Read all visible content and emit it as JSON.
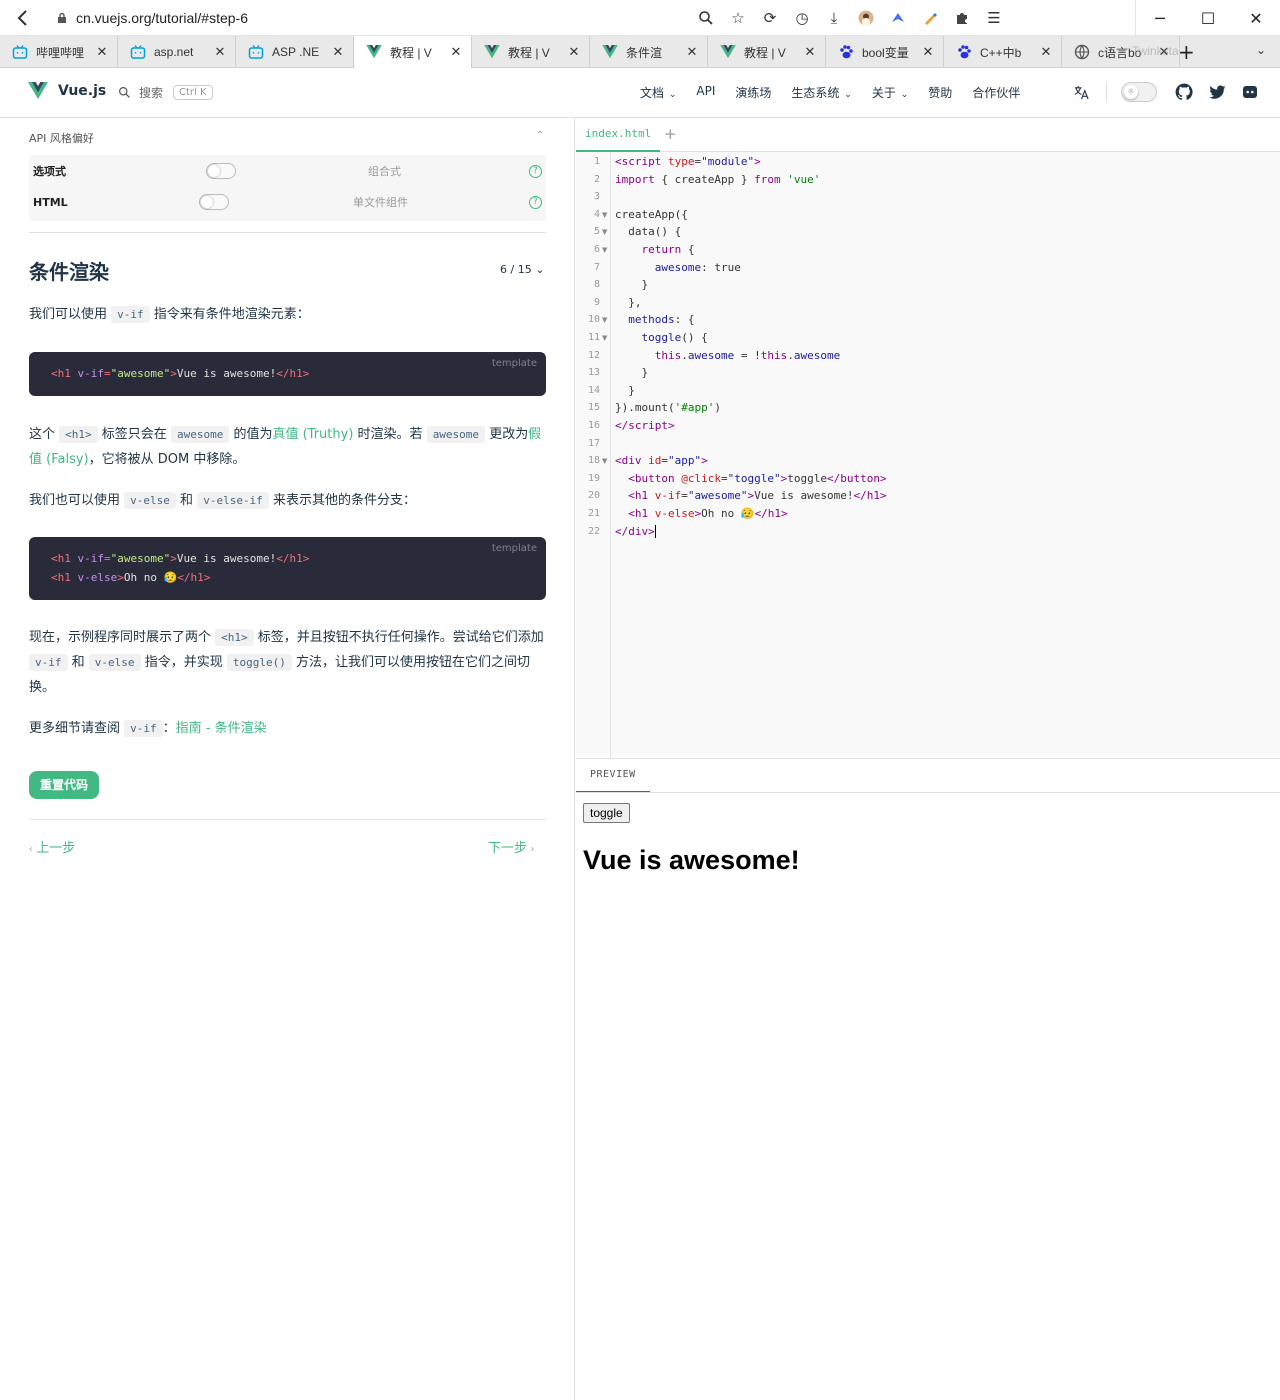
{
  "browser": {
    "url": "cn.vuejs.org/tutorial/#step-6",
    "tabs": [
      {
        "label": "哔哩哔哩",
        "icon": "bilibili-icon",
        "active": false
      },
      {
        "label": "asp.net",
        "icon": "bilibili-icon",
        "active": false
      },
      {
        "label": "ASP .NE",
        "icon": "bilibili-icon",
        "active": false
      },
      {
        "label": "教程 | V",
        "icon": "vue-icon",
        "active": true
      },
      {
        "label": "教程 | V",
        "icon": "vue-icon",
        "active": false
      },
      {
        "label": "条件渲",
        "icon": "vue-icon",
        "active": false
      },
      {
        "label": "教程 | V",
        "icon": "vue-icon",
        "active": false
      },
      {
        "label": "bool变量",
        "icon": "baidu-icon",
        "active": false
      },
      {
        "label": "C++中b",
        "icon": "baidu-icon",
        "active": false
      },
      {
        "label": "c语言bo",
        "icon": "globe-icon",
        "active": false
      }
    ],
    "tab_overlay": "Twinkstar Browser"
  },
  "nav": {
    "logo": "Vue.js",
    "search": "搜索",
    "search_kbd": "Ctrl K",
    "items": [
      "文档",
      "API",
      "演练场",
      "生态系统",
      "关于",
      "赞助",
      "合作伙伴"
    ]
  },
  "prefs": {
    "heading": "API 风格偏好",
    "row1_left": "选项式",
    "row1_right": "组合式",
    "row2_left": "HTML",
    "row2_right": "单文件组件"
  },
  "lesson": {
    "title": "条件渲染",
    "count": "6 / 15",
    "p1_a": "我们可以使用",
    "p1_code": "v-if",
    "p1_b": "指令来有条件地渲染元素：",
    "code1_lang": "template",
    "p2_a": "这个",
    "p2_code1": "<h1>",
    "p2_b": "标签只会在",
    "p2_code2": "awesome",
    "p2_c": "的值为",
    "p2_link1": "真值 (Truthy)",
    "p2_d": "时渲染。若",
    "p2_code3": "awesome",
    "p2_e": "更改为",
    "p2_link2": "假值 (Falsy)",
    "p2_f": "，它将被从 DOM 中移除。",
    "p3_a": "我们也可以使用",
    "p3_code1": "v-else",
    "p3_b": "和",
    "p3_code2": "v-else-if",
    "p3_c": "来表示其他的条件分支：",
    "code2_lang": "template",
    "p4_a": "现在，示例程序同时展示了两个",
    "p4_code1": "<h1>",
    "p4_b": "标签，并且按钮不执行任何操作。尝试给它们添加",
    "p4_code2": "v-if",
    "p4_c": "和",
    "p4_code3": "v-else",
    "p4_d": "指令，并实现",
    "p4_code4": "toggle()",
    "p4_e": "方法，让我们可以使用按钮在它们之间切换。",
    "p5_a": "更多细节请查阅",
    "p5_code": "v-if",
    "p5_b": "：",
    "p5_link": "指南 - 条件渲染",
    "reset": "重置代码",
    "prev": "上一步",
    "next": "下一步"
  },
  "editor": {
    "tab": "index.html",
    "add": "+"
  },
  "preview": {
    "tab": "PREVIEW",
    "button": "toggle",
    "heading": "Vue is awesome!"
  },
  "colors": {
    "accent": "#42b883",
    "codebg": "#292b3a"
  }
}
